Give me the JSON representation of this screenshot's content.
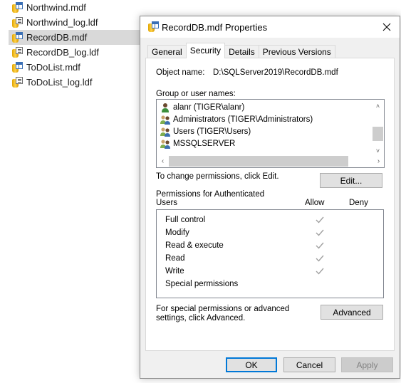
{
  "explorer": {
    "files": [
      {
        "name": "Northwind.mdf",
        "type": "mdf",
        "selected": false
      },
      {
        "name": "Northwind_log.ldf",
        "type": "ldf",
        "selected": false
      },
      {
        "name": "RecordDB.mdf",
        "type": "mdf",
        "selected": true
      },
      {
        "name": "RecordDB_log.ldf",
        "type": "ldf",
        "selected": false
      },
      {
        "name": "ToDoList.mdf",
        "type": "mdf",
        "selected": false
      },
      {
        "name": "ToDoList_log.ldf",
        "type": "ldf",
        "selected": false
      }
    ]
  },
  "dialog": {
    "title": "RecordDB.mdf Properties",
    "close_icon": "close-icon",
    "tabs": [
      {
        "label": "General",
        "active": false
      },
      {
        "label": "Security",
        "active": true
      },
      {
        "label": "Details",
        "active": false
      },
      {
        "label": "Previous Versions",
        "active": false
      }
    ],
    "object_name_label": "Object name:",
    "object_name_value": "D:\\SQLServer2019\\RecordDB.mdf",
    "group_label": "Group or user names:",
    "users": [
      {
        "name": "alanr (TIGER\\alanr)",
        "icon": "user-icon"
      },
      {
        "name": "Administrators (TIGER\\Administrators)",
        "icon": "group-icon"
      },
      {
        "name": "Users (TIGER\\Users)",
        "icon": "group-icon"
      },
      {
        "name": "MSSQLSERVER",
        "icon": "group-icon"
      }
    ],
    "change_text": "To change permissions, click Edit.",
    "edit_button": "Edit...",
    "permissions_for": "Permissions for Authenticated Users",
    "allow_header": "Allow",
    "deny_header": "Deny",
    "permissions": [
      {
        "name": "Full control",
        "allow": true,
        "deny": false
      },
      {
        "name": "Modify",
        "allow": true,
        "deny": false
      },
      {
        "name": "Read & execute",
        "allow": true,
        "deny": false
      },
      {
        "name": "Read",
        "allow": true,
        "deny": false
      },
      {
        "name": "Write",
        "allow": true,
        "deny": false
      },
      {
        "name": "Special permissions",
        "allow": false,
        "deny": false
      }
    ],
    "advanced_text": "For special permissions or advanced settings, click Advanced.",
    "advanced_button": "Advanced",
    "ok_button": "OK",
    "cancel_button": "Cancel",
    "apply_button": "Apply"
  },
  "colors": {
    "focus_border": "#0078d7",
    "selected_row": "#d9d9d9",
    "check_gray": "#a0a0a0"
  }
}
